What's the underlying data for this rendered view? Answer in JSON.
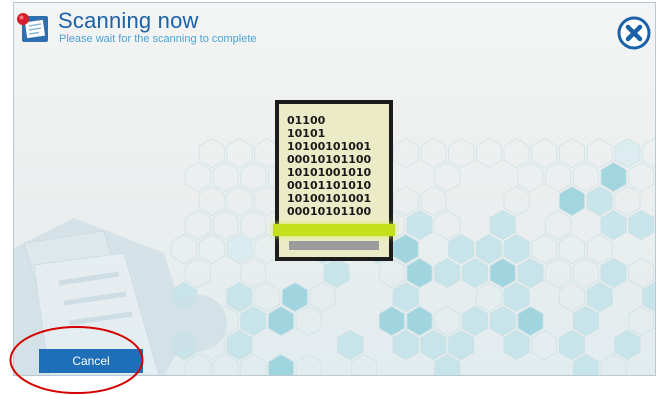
{
  "header": {
    "title": "Scanning now",
    "subtitle": "Please wait for the scanning to complete",
    "app_icon": "scanner-document-icon",
    "close_icon": "close-circle-icon"
  },
  "scan_document": {
    "lines": [
      "01100",
      "10101",
      "10100101001",
      "00010101100",
      "10101001010",
      "00101101010",
      "10100101001",
      "00010101100"
    ]
  },
  "footer": {
    "cancel_label": "Cancel"
  },
  "colors": {
    "accent": "#1b61a7",
    "subtitle": "#4aa3d6",
    "button": "#1f6fb8",
    "scan_bar": "#c4e01c",
    "annotation": "#d40000"
  }
}
